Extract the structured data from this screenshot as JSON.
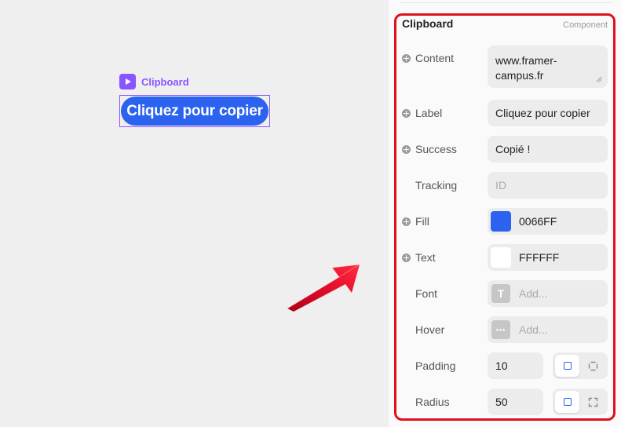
{
  "canvas": {
    "component_name": "Clipboard",
    "button_label": "Cliquez pour copier",
    "button_color": "#2b63f0",
    "accent_color": "#8855ff"
  },
  "panel": {
    "title": "Clipboard",
    "type": "Component",
    "highlight_color": "#e0101c",
    "content": {
      "label": "Content",
      "value_line1": "www.framer-",
      "value_line2": "campus.fr"
    },
    "label_row": {
      "label": "Label",
      "value": "Cliquez pour copier"
    },
    "success": {
      "label": "Success",
      "value": "Copié !"
    },
    "tracking": {
      "label": "Tracking",
      "placeholder": "ID"
    },
    "fill": {
      "label": "Fill",
      "value": "0066FF",
      "swatch": "#2b63f0"
    },
    "text": {
      "label": "Text",
      "value": "FFFFFF",
      "swatch": "#ffffff"
    },
    "font": {
      "label": "Font",
      "placeholder": "Add...",
      "icon_glyph": "T"
    },
    "hover": {
      "label": "Hover",
      "placeholder": "Add...",
      "icon_glyph": "•••"
    },
    "padding": {
      "label": "Padding",
      "value": "10"
    },
    "radius": {
      "label": "Radius",
      "value": "50"
    }
  }
}
